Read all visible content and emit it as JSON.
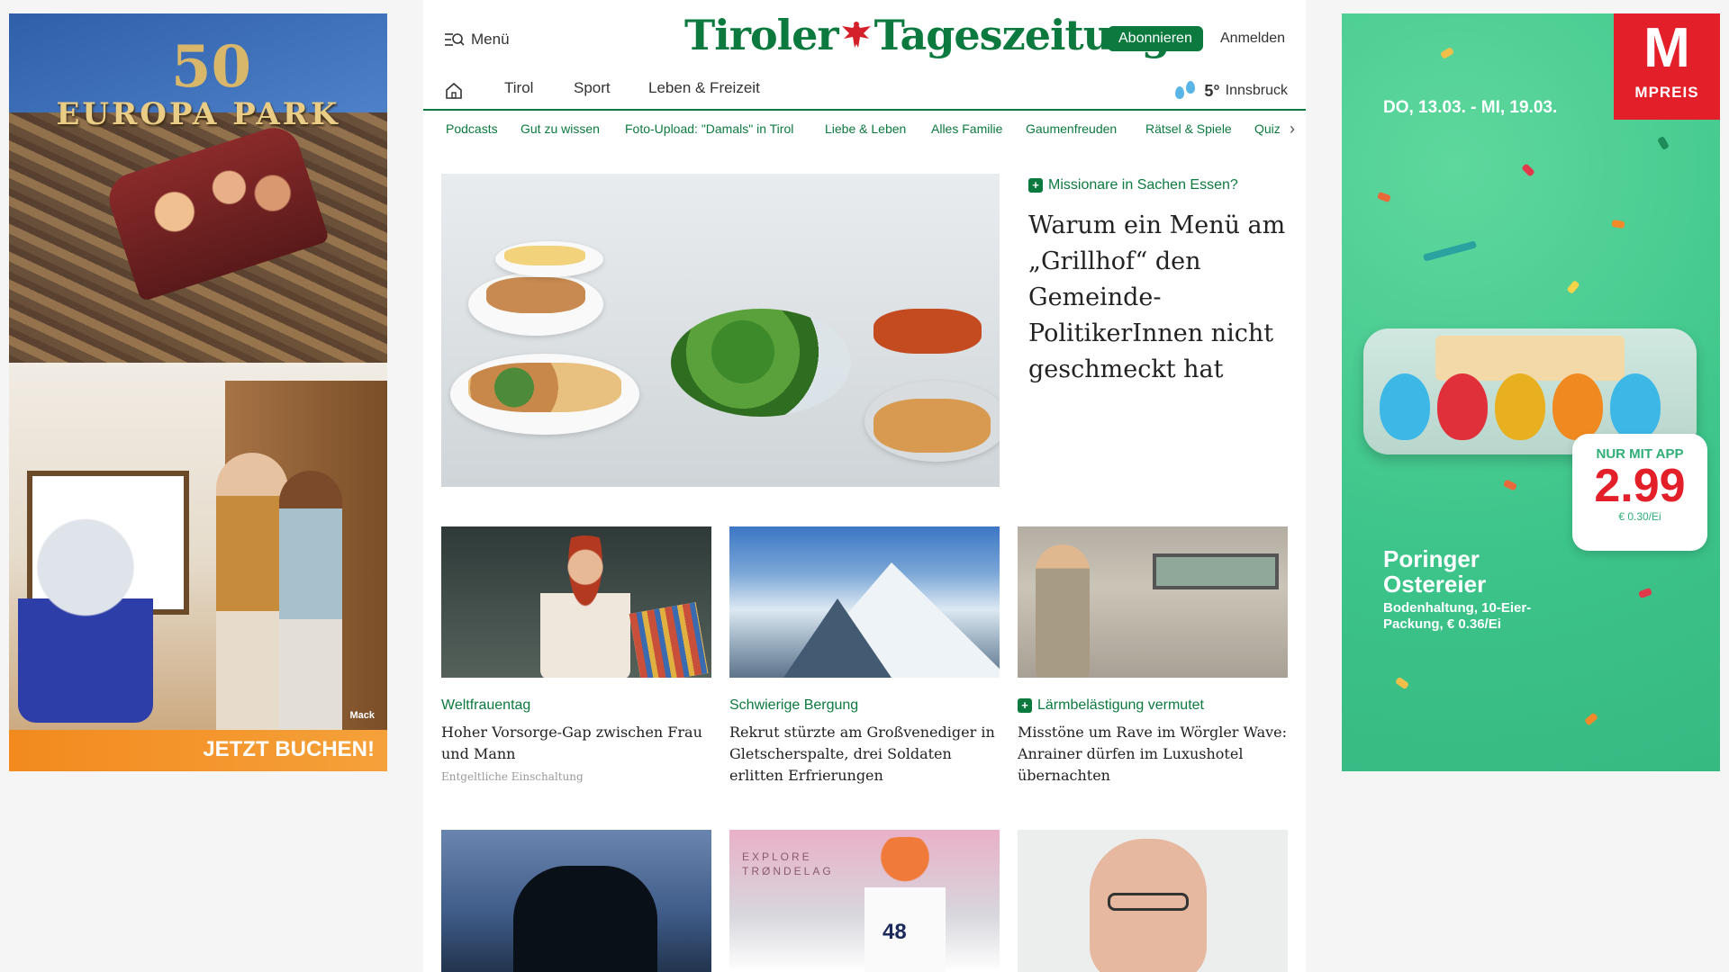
{
  "ad_left": {
    "anniversary": "50",
    "brand": "EUROPA PARK",
    "cta": "JETZT BUCHEN!",
    "sponsor": "Mack"
  },
  "ad_right": {
    "logo_letter": "M",
    "logo_name": "MPREIS",
    "date_range": "DO, 13.03. - MI, 19.03.",
    "app_only": "NUR MIT APP",
    "price": "2.99",
    "price_unit": "€ 0.30/Ei",
    "product_name": "Poringer Ostereier",
    "product_desc": "Bodenhaltung, 10-Eier-Packung, € 0.36/Ei",
    "accent_color": "#e3202a"
  },
  "header": {
    "menu_label": "Menü",
    "brand_left": "Tiroler",
    "brand_right": "Tageszeitung",
    "subscribe_label": "Abonnieren",
    "login_label": "Anmelden",
    "brand_color": "#0c7a3f"
  },
  "nav": {
    "items": [
      "Tirol",
      "Sport",
      "Leben & Freizeit"
    ],
    "weather_temp": "5°",
    "weather_city": "Innsbruck"
  },
  "subnav": {
    "items": [
      "Podcasts",
      "Gut zu wissen",
      "Foto-Upload: \"Damals\" in Tirol",
      "Liebe & Leben",
      "Alles Familie",
      "Gaumenfreuden",
      "Rätsel & Spiele",
      "Quiz"
    ]
  },
  "hero": {
    "category": "Missionare in Sachen Essen?",
    "title": "Warum ein Menü am „Grillhof“ den Gemeinde-PolitikerInnen nicht geschmeckt hat"
  },
  "cards": [
    {
      "category": "Weltfrauentag",
      "title": "Hoher Vorsorge-Gap zwischen Frau und Mann",
      "sponsored": "Entgeltliche Einschaltung"
    },
    {
      "category": "Schwierige Bergung",
      "title": "Rekrut stürzte am Großvenediger in Gletscherspalte, drei Soldaten erlitten Erfrierungen"
    },
    {
      "category": "Lärmbelästigung vermutet",
      "title": "Misstöne um Rave im Wörgler Wave: Anrainer dürfen im Luxushotel übernachten"
    }
  ],
  "row3": {
    "ski_label": "EXPLORE TRØNDELAG",
    "ski_bib": "48"
  }
}
